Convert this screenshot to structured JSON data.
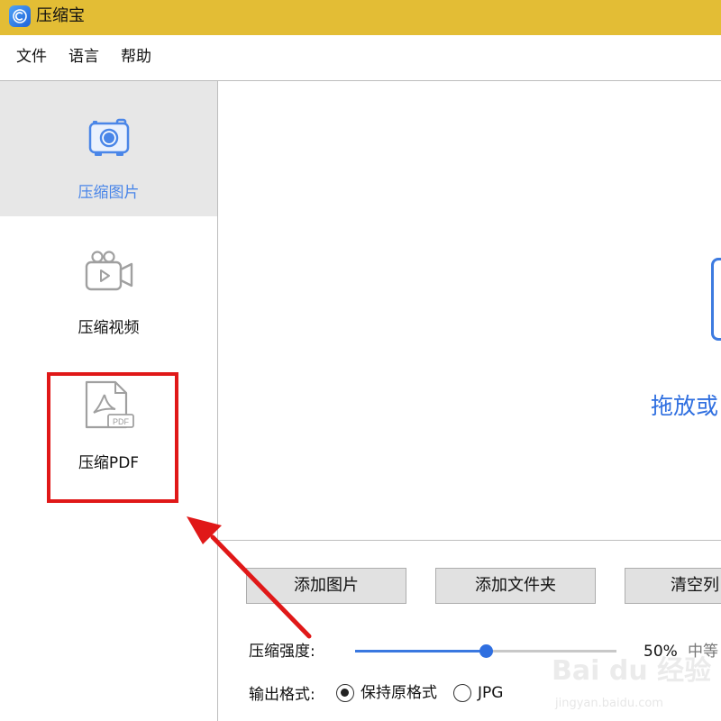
{
  "window": {
    "title": "压缩宝",
    "app_icon": "compress-logo-icon",
    "titlebar_color": "#e3bd35"
  },
  "menu": {
    "items": [
      "文件",
      "语言",
      "帮助"
    ]
  },
  "sidebar": {
    "items": [
      {
        "label": "压缩图片",
        "icon": "camera-icon",
        "active": true,
        "active_color": "#4a86e8"
      },
      {
        "label": "压缩视频",
        "icon": "video-camera-icon",
        "active": false
      },
      {
        "label": "压缩PDF",
        "icon": "pdf-file-icon",
        "active": false
      }
    ]
  },
  "dropzone": {
    "text": "拖放或",
    "accent": "#2f6fe0"
  },
  "buttons": {
    "add_image": "添加图片",
    "add_folder": "添加文件夹",
    "clear_list": "清空列"
  },
  "settings": {
    "strength": {
      "label": "压缩强度:",
      "value_percent": 50,
      "value_text": "50%",
      "level_text": "中等"
    },
    "format": {
      "label": "输出格式:",
      "options": [
        {
          "label": "保持原格式",
          "selected": true
        },
        {
          "label": "JPG",
          "selected": false
        }
      ]
    }
  },
  "annotation": {
    "highlight_color": "#e01818"
  },
  "watermark": {
    "text": "Bai du 经验",
    "subtext": "jingyan.baidu.com"
  }
}
